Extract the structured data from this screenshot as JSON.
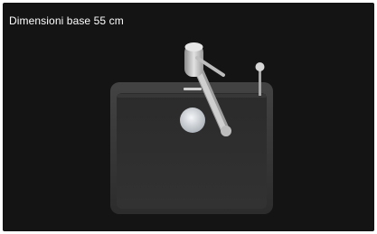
{
  "caption": {
    "text": "Dimensioni base 55 cm"
  },
  "colors": {
    "background": "#141414",
    "sink": "#2a2a2a",
    "sink_rim": "#3b3b3b",
    "drain": "#d9dde2",
    "faucet": "#c9c9c9"
  },
  "icons": [
    "sink-image",
    "faucet-image",
    "soap-dispenser-image",
    "drain-image",
    "overflow-slot-image"
  ]
}
